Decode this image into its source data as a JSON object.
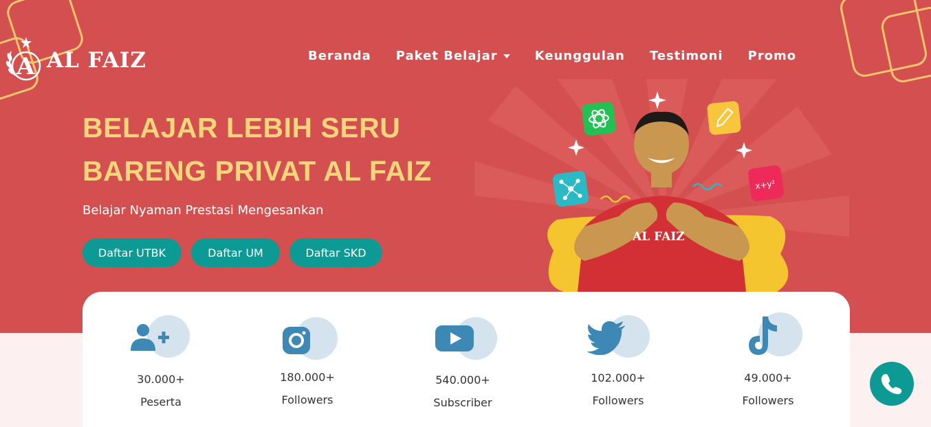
{
  "brand": {
    "name": "AL FAIZ"
  },
  "nav": {
    "items": [
      {
        "label": "Beranda"
      },
      {
        "label": "Paket Belajar"
      },
      {
        "label": "Keunggulan"
      },
      {
        "label": "Testimoni"
      },
      {
        "label": "Promo"
      }
    ]
  },
  "hero": {
    "title_line1": "BELAJAR LEBIH SERU",
    "title_line2": "BARENG PRIVAT AL FAIZ",
    "subtitle": "Belajar Nyaman Prestasi Mengesankan",
    "buttons": [
      {
        "label": "Daftar UTBK"
      },
      {
        "label": "Daftar UM"
      },
      {
        "label": "Daftar SKD"
      }
    ],
    "shirt_text": "AL FAIZ"
  },
  "stats": [
    {
      "icon": "user-plus-icon",
      "count": "30.000+",
      "label": "Peserta"
    },
    {
      "icon": "instagram-icon",
      "count": "180.000+",
      "label": "Followers"
    },
    {
      "icon": "youtube-icon",
      "count": "540.000+",
      "label": "Subscriber"
    },
    {
      "icon": "twitter-icon",
      "count": "102.000+",
      "label": "Followers"
    },
    {
      "icon": "tiktok-icon",
      "count": "49.000+",
      "label": "Followers"
    }
  ],
  "colors": {
    "hero_bg": "#d45050",
    "accent_yellow": "#f7d57a",
    "teal": "#0e9a94",
    "icon_blue": "#3d88b5"
  },
  "fab": {
    "icon": "phone-icon"
  }
}
